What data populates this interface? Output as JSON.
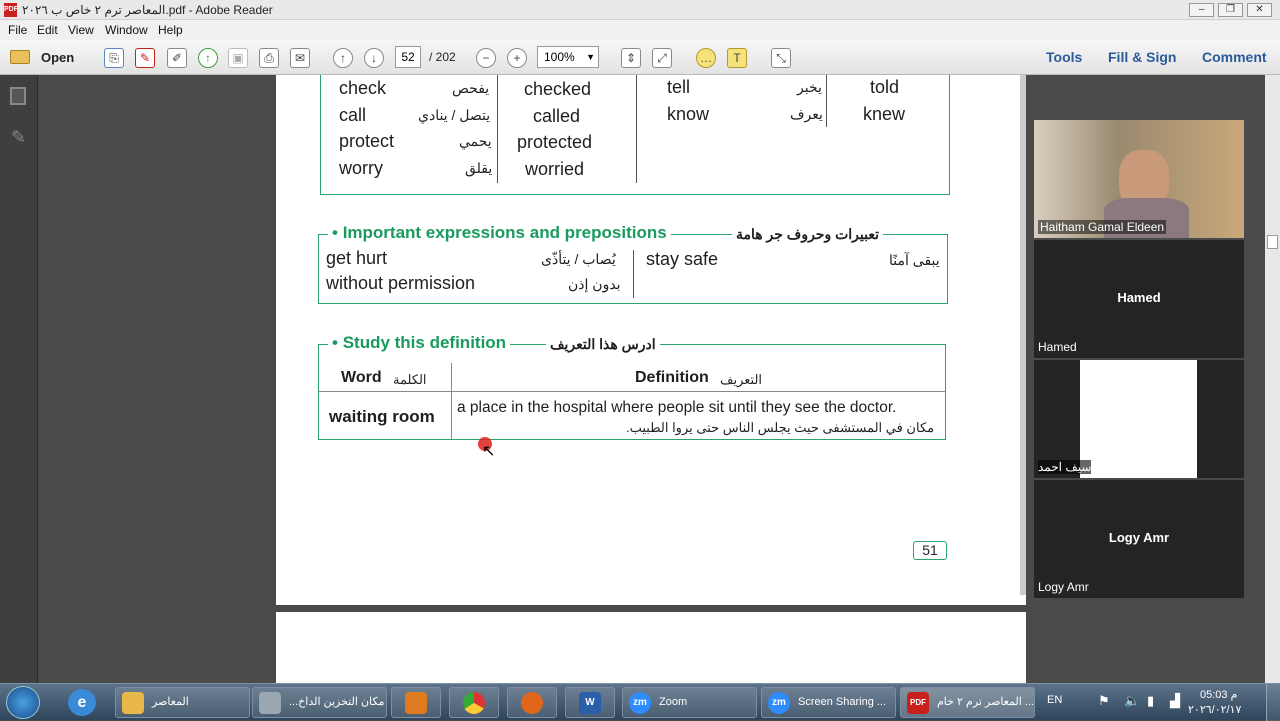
{
  "window": {
    "title": "المعاصر ترم ٢ خاص ب ٢٠٢٦.pdf - Adobe Reader",
    "pdf_badge": "PDF"
  },
  "menu": [
    "File",
    "Edit",
    "View",
    "Window",
    "Help"
  ],
  "toolbar": {
    "open_label": "Open",
    "page_current": "52",
    "page_total": "/ 202",
    "zoom": "100%",
    "tools_label": "Tools",
    "fill_sign_label": "Fill & Sign",
    "comment_label": "Comment"
  },
  "icons": {
    "open": "folder-icon",
    "create": "create-pdf-icon",
    "edit": "edit-icon",
    "upload": "cloud-upload-icon",
    "save": "save-icon",
    "print": "print-icon",
    "mail": "mail-icon",
    "prev": "arrow-up-icon",
    "next": "arrow-down-icon",
    "zoom_out": "minus-icon",
    "zoom_in": "plus-icon",
    "fit": "fit-page-icon",
    "full": "fullscreen-icon",
    "comment": "comment-icon",
    "highlight": "highlight-icon",
    "expand": "expand-icon",
    "pages": "pages-panel-icon",
    "attach": "attachment-icon"
  },
  "document": {
    "verbs_left": [
      {
        "en": "check",
        "ar": "يفحص",
        "past": "checked"
      },
      {
        "en": "call",
        "ar": "يتصل / ينادي",
        "past": "called"
      },
      {
        "en": "protect",
        "ar": "يحمي",
        "past": "protected"
      },
      {
        "en": "worry",
        "ar": "يقلق",
        "past": "worried"
      }
    ],
    "verbs_right": [
      {
        "en": "tell",
        "ar": "يخبر",
        "past": "told"
      },
      {
        "en": "know",
        "ar": "يعرف",
        "past": "knew"
      }
    ],
    "expressions_title": "Important expressions and prepositions",
    "expressions_title_ar": "تعبيرات وحروف جر هامة",
    "expressions": [
      {
        "en": "get hurt",
        "ar": "يُصاب / يتأذّى"
      },
      {
        "en": "without permission",
        "ar": "بدون إذن"
      },
      {
        "en": "stay safe",
        "ar": "يبقى آمنًا"
      }
    ],
    "definition_title": "Study this definition",
    "definition_title_ar": "ادرس هذا التعريف",
    "col_word": "Word",
    "col_word_ar": "الكلمة",
    "col_definition": "Definition",
    "col_definition_ar": "التعريف",
    "word": "waiting room",
    "definition_en": "a place in the hospital where people sit until they see the doctor.",
    "definition_ar": "مكان في المستشفى حيث يجلس الناس حتى يروا الطبيب.",
    "page_number": "51"
  },
  "participants": [
    {
      "name": "Haitham Gamal Eldeen",
      "center": ""
    },
    {
      "name": "Hamed",
      "center": "Hamed"
    },
    {
      "name": "سيف احمد",
      "center": ""
    },
    {
      "name": "Logy Amr",
      "center": "Logy Amr"
    }
  ],
  "taskbar": {
    "items": [
      {
        "label": "المعاصر",
        "icon": "folder-icon",
        "color": "#e8b84a"
      },
      {
        "label": "...مكان التخزين الداخ",
        "icon": "drive-icon",
        "color": "#9aa7b3"
      },
      {
        "label": "",
        "icon": "media-player-icon",
        "color": "#e07a1f"
      },
      {
        "label": "",
        "icon": "chrome-icon",
        "color": "#3a8a3a"
      },
      {
        "label": "",
        "icon": "firefox-icon",
        "color": "#e0661c"
      },
      {
        "label": "",
        "icon": "word-icon",
        "color": "#2b5faa"
      },
      {
        "label": "Zoom",
        "icon": "zoom-icon",
        "color": "#2d8cff"
      },
      {
        "label": "Screen Sharing ...",
        "icon": "zoom-share-icon",
        "color": "#2d8cff"
      },
      {
        "label": "المعاصر ترم ٢ خام ...",
        "icon": "pdf-icon",
        "color": "#c8201c"
      }
    ],
    "icon_text": {
      "zoom": "zm",
      "word": "W",
      "pdf": "PDF"
    },
    "lang": "EN",
    "time": "05:03 م",
    "date": "٢٠٢٦/٠٢/١٧"
  },
  "colors": {
    "accent_green": "#1a9a5e",
    "adobe_blue": "#2b5a9a",
    "cursor_red": "#e02020"
  }
}
